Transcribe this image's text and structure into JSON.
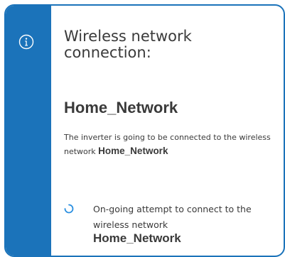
{
  "dialog": {
    "icon": "info-icon",
    "title": "Wireless network connection:",
    "network_name": "Home_Network",
    "description_prefix": "The inverter is going to be connected to the wireless network",
    "description_network": "Home_Network",
    "status": {
      "icon": "loading-spinner-icon",
      "text": "On-going attempt to connect to the wireless network",
      "network": "Home_Network"
    }
  },
  "colors": {
    "accent": "#1b73ba",
    "text": "#3a3a3a",
    "spinner": "#2a8fe0",
    "background": "#ffffff"
  }
}
